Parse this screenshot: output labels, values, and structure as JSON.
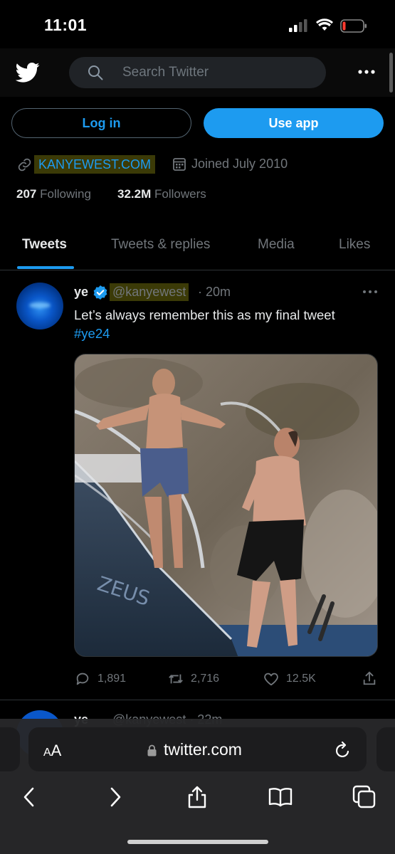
{
  "status": {
    "time": "11:01"
  },
  "header": {
    "search_placeholder": "Search Twitter"
  },
  "buttons": {
    "login": "Log in",
    "use_app": "Use app"
  },
  "profile": {
    "website": "KANYEWEST.COM",
    "joined": "Joined July 2010",
    "following_count": "207",
    "following_label": "Following",
    "followers_count": "32.2M",
    "followers_label": "Followers"
  },
  "tabs": [
    {
      "label": "Tweets",
      "active": true
    },
    {
      "label": "Tweets & replies",
      "active": false
    },
    {
      "label": "Media",
      "active": false
    },
    {
      "label": "Likes",
      "active": false
    }
  ],
  "tweet": {
    "name": "ye",
    "handle": "@kanyewest",
    "time": "· 20m",
    "text": "Let’s always remember this as my final tweet",
    "hashtag": "#ye24",
    "replies": "1,891",
    "retweets": "2,716",
    "likes": "12.5K"
  },
  "next_tweet": {
    "name": "ye",
    "handle": "@kanyewest · 22m"
  },
  "browser": {
    "text_size_label_small": "A",
    "text_size_label_large": "A",
    "url": "twitter.com"
  },
  "colors": {
    "accent": "#1d9bf0",
    "highlight": "#3b3a07",
    "background": "#000000"
  }
}
